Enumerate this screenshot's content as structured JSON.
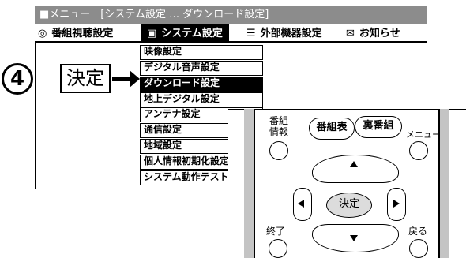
{
  "menu": {
    "title": "■メニュー　[システム設定 … ダウンロード設定]",
    "tabs": [
      {
        "icon": "◎",
        "label": "番組視聴設定",
        "active": false
      },
      {
        "icon": "▣",
        "label": "システム設定",
        "active": true
      },
      {
        "icon": "☰",
        "label": "外部機器設定",
        "active": false
      },
      {
        "icon": "✉",
        "label": "お知らせ",
        "active": false
      }
    ],
    "items": [
      {
        "label": "映像設定",
        "selected": false
      },
      {
        "label": "デジタル音声設定",
        "selected": false
      },
      {
        "label": "ダウンロード設定",
        "selected": true
      },
      {
        "label": "地上デジタル設定",
        "selected": false
      },
      {
        "label": "アンテナ設定",
        "selected": false
      },
      {
        "label": "通信設定",
        "selected": false
      },
      {
        "label": "地域設定",
        "selected": false
      },
      {
        "label": "個人情報初期化設定",
        "selected": false
      },
      {
        "label": "システム動作テスト",
        "selected": false
      }
    ]
  },
  "step": {
    "number": "4",
    "action_label": "決定"
  },
  "remote": {
    "bangumi_joho": [
      "番組",
      "情報"
    ],
    "bangumihyo": "番組表",
    "urabangumi": "裏番組",
    "menu": "メニュー",
    "kettei": "決定",
    "shuryo": "終了",
    "modoru": "戻る"
  },
  "colors": {
    "title_bg": "#8c8c8c",
    "selected_bg": "#000000",
    "rail": "#c4c4c4",
    "kettei_btn": "#dcdcdc"
  }
}
